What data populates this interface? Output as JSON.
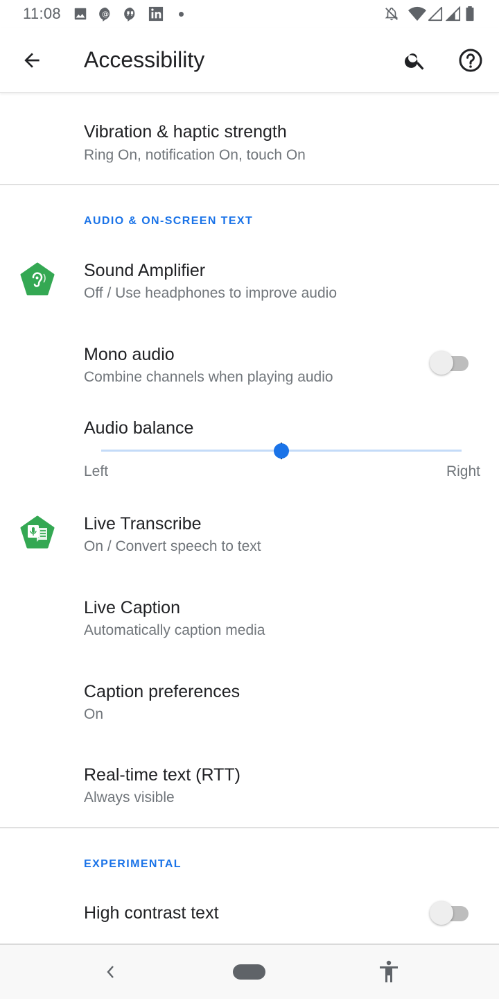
{
  "status_bar": {
    "time": "11:08",
    "left_icons": [
      "image-icon",
      "at-sign-icon",
      "quote-chat-icon",
      "linkedin-icon",
      "dot-icon"
    ],
    "right_icons": [
      "notifications-off-icon",
      "wifi-icon",
      "signal-icon",
      "signal-icon",
      "battery-icon"
    ]
  },
  "app_bar": {
    "title": "Accessibility",
    "back_icon": "arrow-back-icon",
    "search_icon": "search-icon",
    "help_icon": "help-icon"
  },
  "items": {
    "vibration": {
      "title": "Vibration & haptic strength",
      "summary": "Ring On, notification On, touch On"
    },
    "sound_amplifier": {
      "title": "Sound Amplifier",
      "summary": "Off / Use headphones to improve audio",
      "icon": "ear-icon",
      "icon_color": "#34a853"
    },
    "mono_audio": {
      "title": "Mono audio",
      "summary": "Combine channels when playing audio",
      "checked": false
    },
    "audio_balance": {
      "title": "Audio balance",
      "left_label": "Left",
      "right_label": "Right",
      "value_fraction": 0.5,
      "accent": "#1a73e8"
    },
    "live_transcribe": {
      "title": "Live Transcribe",
      "summary": "On / Convert speech to text",
      "icon": "mic-transcribe-icon",
      "icon_color": "#34a853"
    },
    "live_caption": {
      "title": "Live Caption",
      "summary": "Automatically caption media"
    },
    "caption_prefs": {
      "title": "Caption preferences",
      "summary": "On"
    },
    "rtt": {
      "title": "Real-time text (RTT)",
      "summary": "Always visible"
    },
    "high_contrast": {
      "title": "High contrast text",
      "checked": false
    }
  },
  "sections": {
    "audio": "AUDIO & ON-SCREEN TEXT",
    "experimental": "EXPERIMENTAL"
  },
  "nav_bar": {
    "back_icon": "nav-back-icon",
    "home_icon": "home-pill-icon",
    "a11y_icon": "accessibility-icon"
  },
  "colors": {
    "accent": "#1a73e8",
    "icon_green": "#34a853"
  }
}
